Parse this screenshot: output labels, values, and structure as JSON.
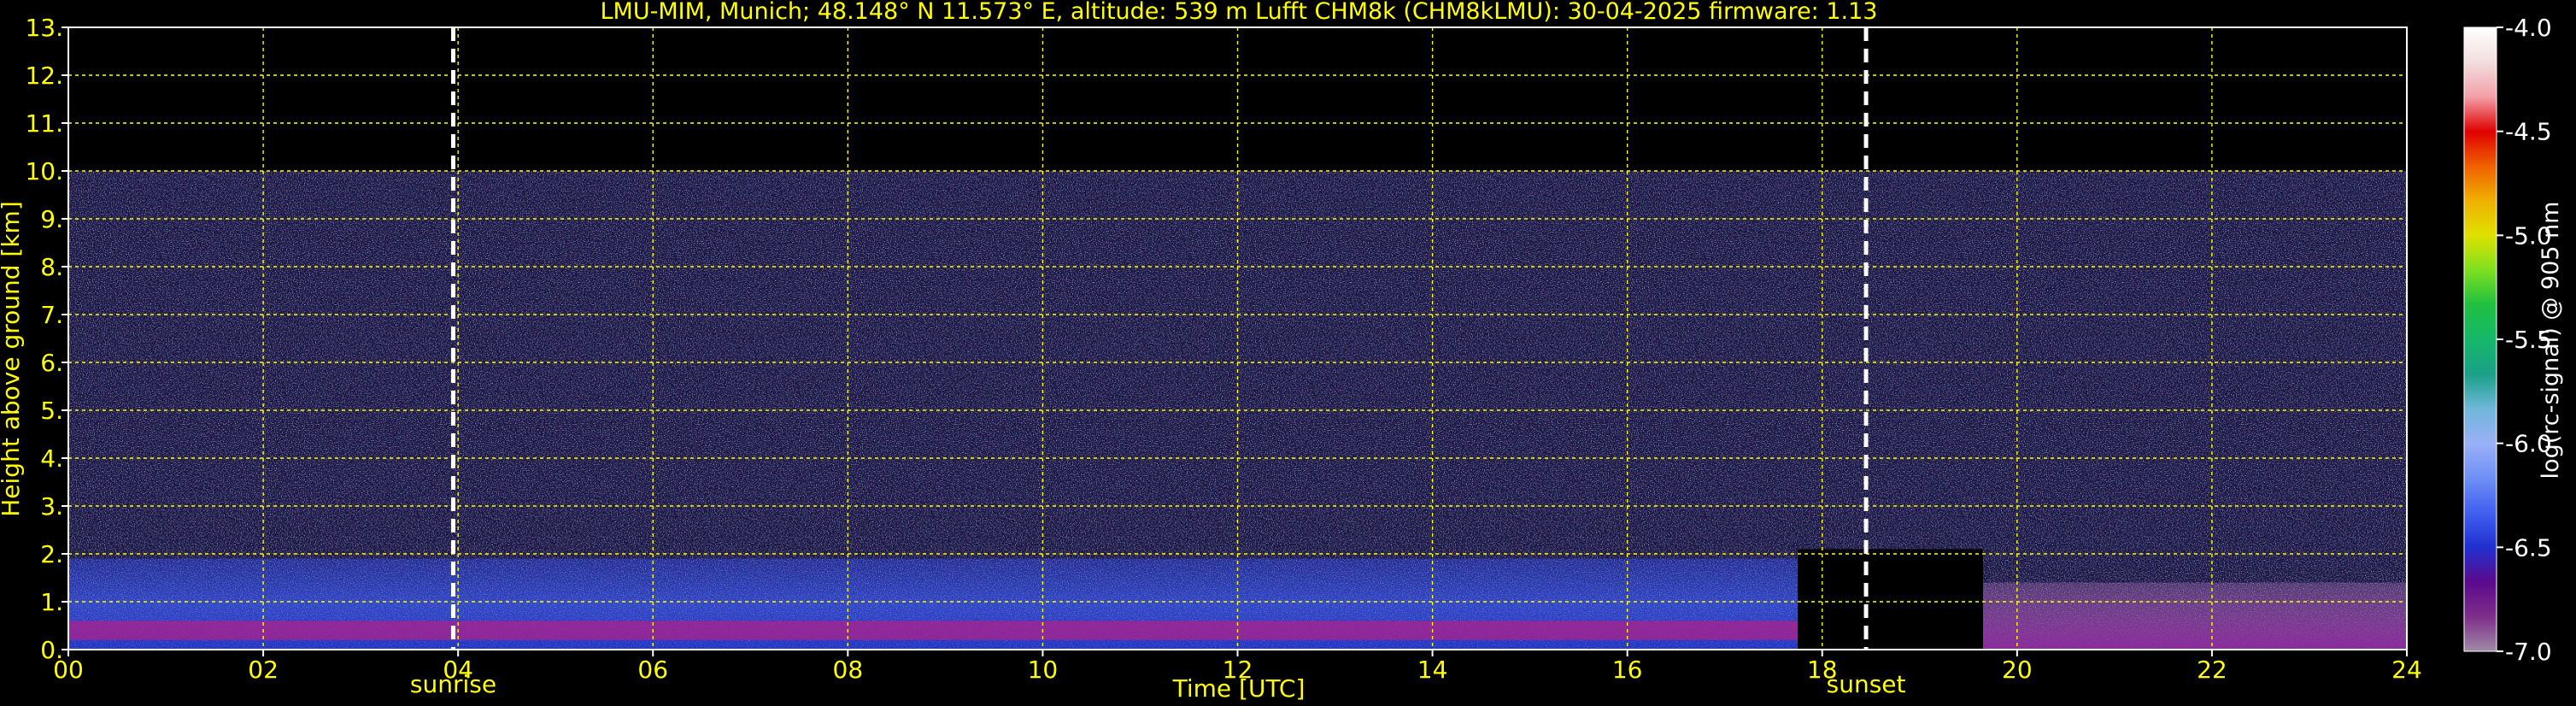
{
  "chart_data": {
    "type": "heatmap",
    "title": "LMU-MIM, Munich; 48.148° N 11.573° E, altitude: 539 m    Lufft CHM8k (CHM8kLMU): 30-04-2025    firmware: 1.13",
    "xlabel": "Time [UTC]",
    "ylabel": "Height above ground [km]",
    "xlim": [
      0,
      24
    ],
    "ylim": [
      0,
      13
    ],
    "x_ticks": [
      "00",
      "02",
      "04",
      "06",
      "08",
      "10",
      "12",
      "14",
      "16",
      "18",
      "20",
      "22",
      "24"
    ],
    "y_ticks": [
      "0.",
      "1.",
      "2.",
      "3.",
      "4.",
      "5.",
      "6.",
      "7.",
      "8.",
      "9.",
      "10.",
      "11.",
      "12.",
      "13."
    ],
    "grid": true,
    "signal_top_km": 10.0,
    "data_gap_hours": [
      17.75,
      19.65
    ],
    "events": [
      {
        "label": "sunrise",
        "hour": 3.95
      },
      {
        "label": "sunset",
        "hour": 18.45
      }
    ],
    "colorbar": {
      "label": "log(rc-signal) @ 905 nm",
      "range": [
        -7.0,
        -4.0
      ],
      "ticks": [
        "-4.0",
        "-4.5",
        "-5.0",
        "-5.5",
        "-6.0",
        "-6.5",
        "-7.0"
      ],
      "stops": [
        "#a08aa6",
        "#7e2e8a",
        "#5a0a8c",
        "#2030d0",
        "#4060f0",
        "#6f8ff5",
        "#9ab0f7",
        "#6fb7d9",
        "#1aa088",
        "#16b86a",
        "#20c040",
        "#7ee020",
        "#e0e000",
        "#f0b000",
        "#f06000",
        "#e00000",
        "#f3a0a8",
        "#f2dede",
        "#ffffff"
      ]
    },
    "layers": [
      {
        "name": "boundary-layer-blue",
        "x": [
          0,
          17.75
        ],
        "height_km": [
          0,
          1.9
        ],
        "color": "#3045d8"
      },
      {
        "name": "residual-layer",
        "x": [
          0,
          17.75
        ],
        "height_km": [
          0.2,
          0.6
        ],
        "color": "#b0208a"
      },
      {
        "name": "night-layer",
        "x": [
          19.65,
          24
        ],
        "height_km": [
          0,
          1.4
        ],
        "color": "#a050b0"
      }
    ]
  }
}
